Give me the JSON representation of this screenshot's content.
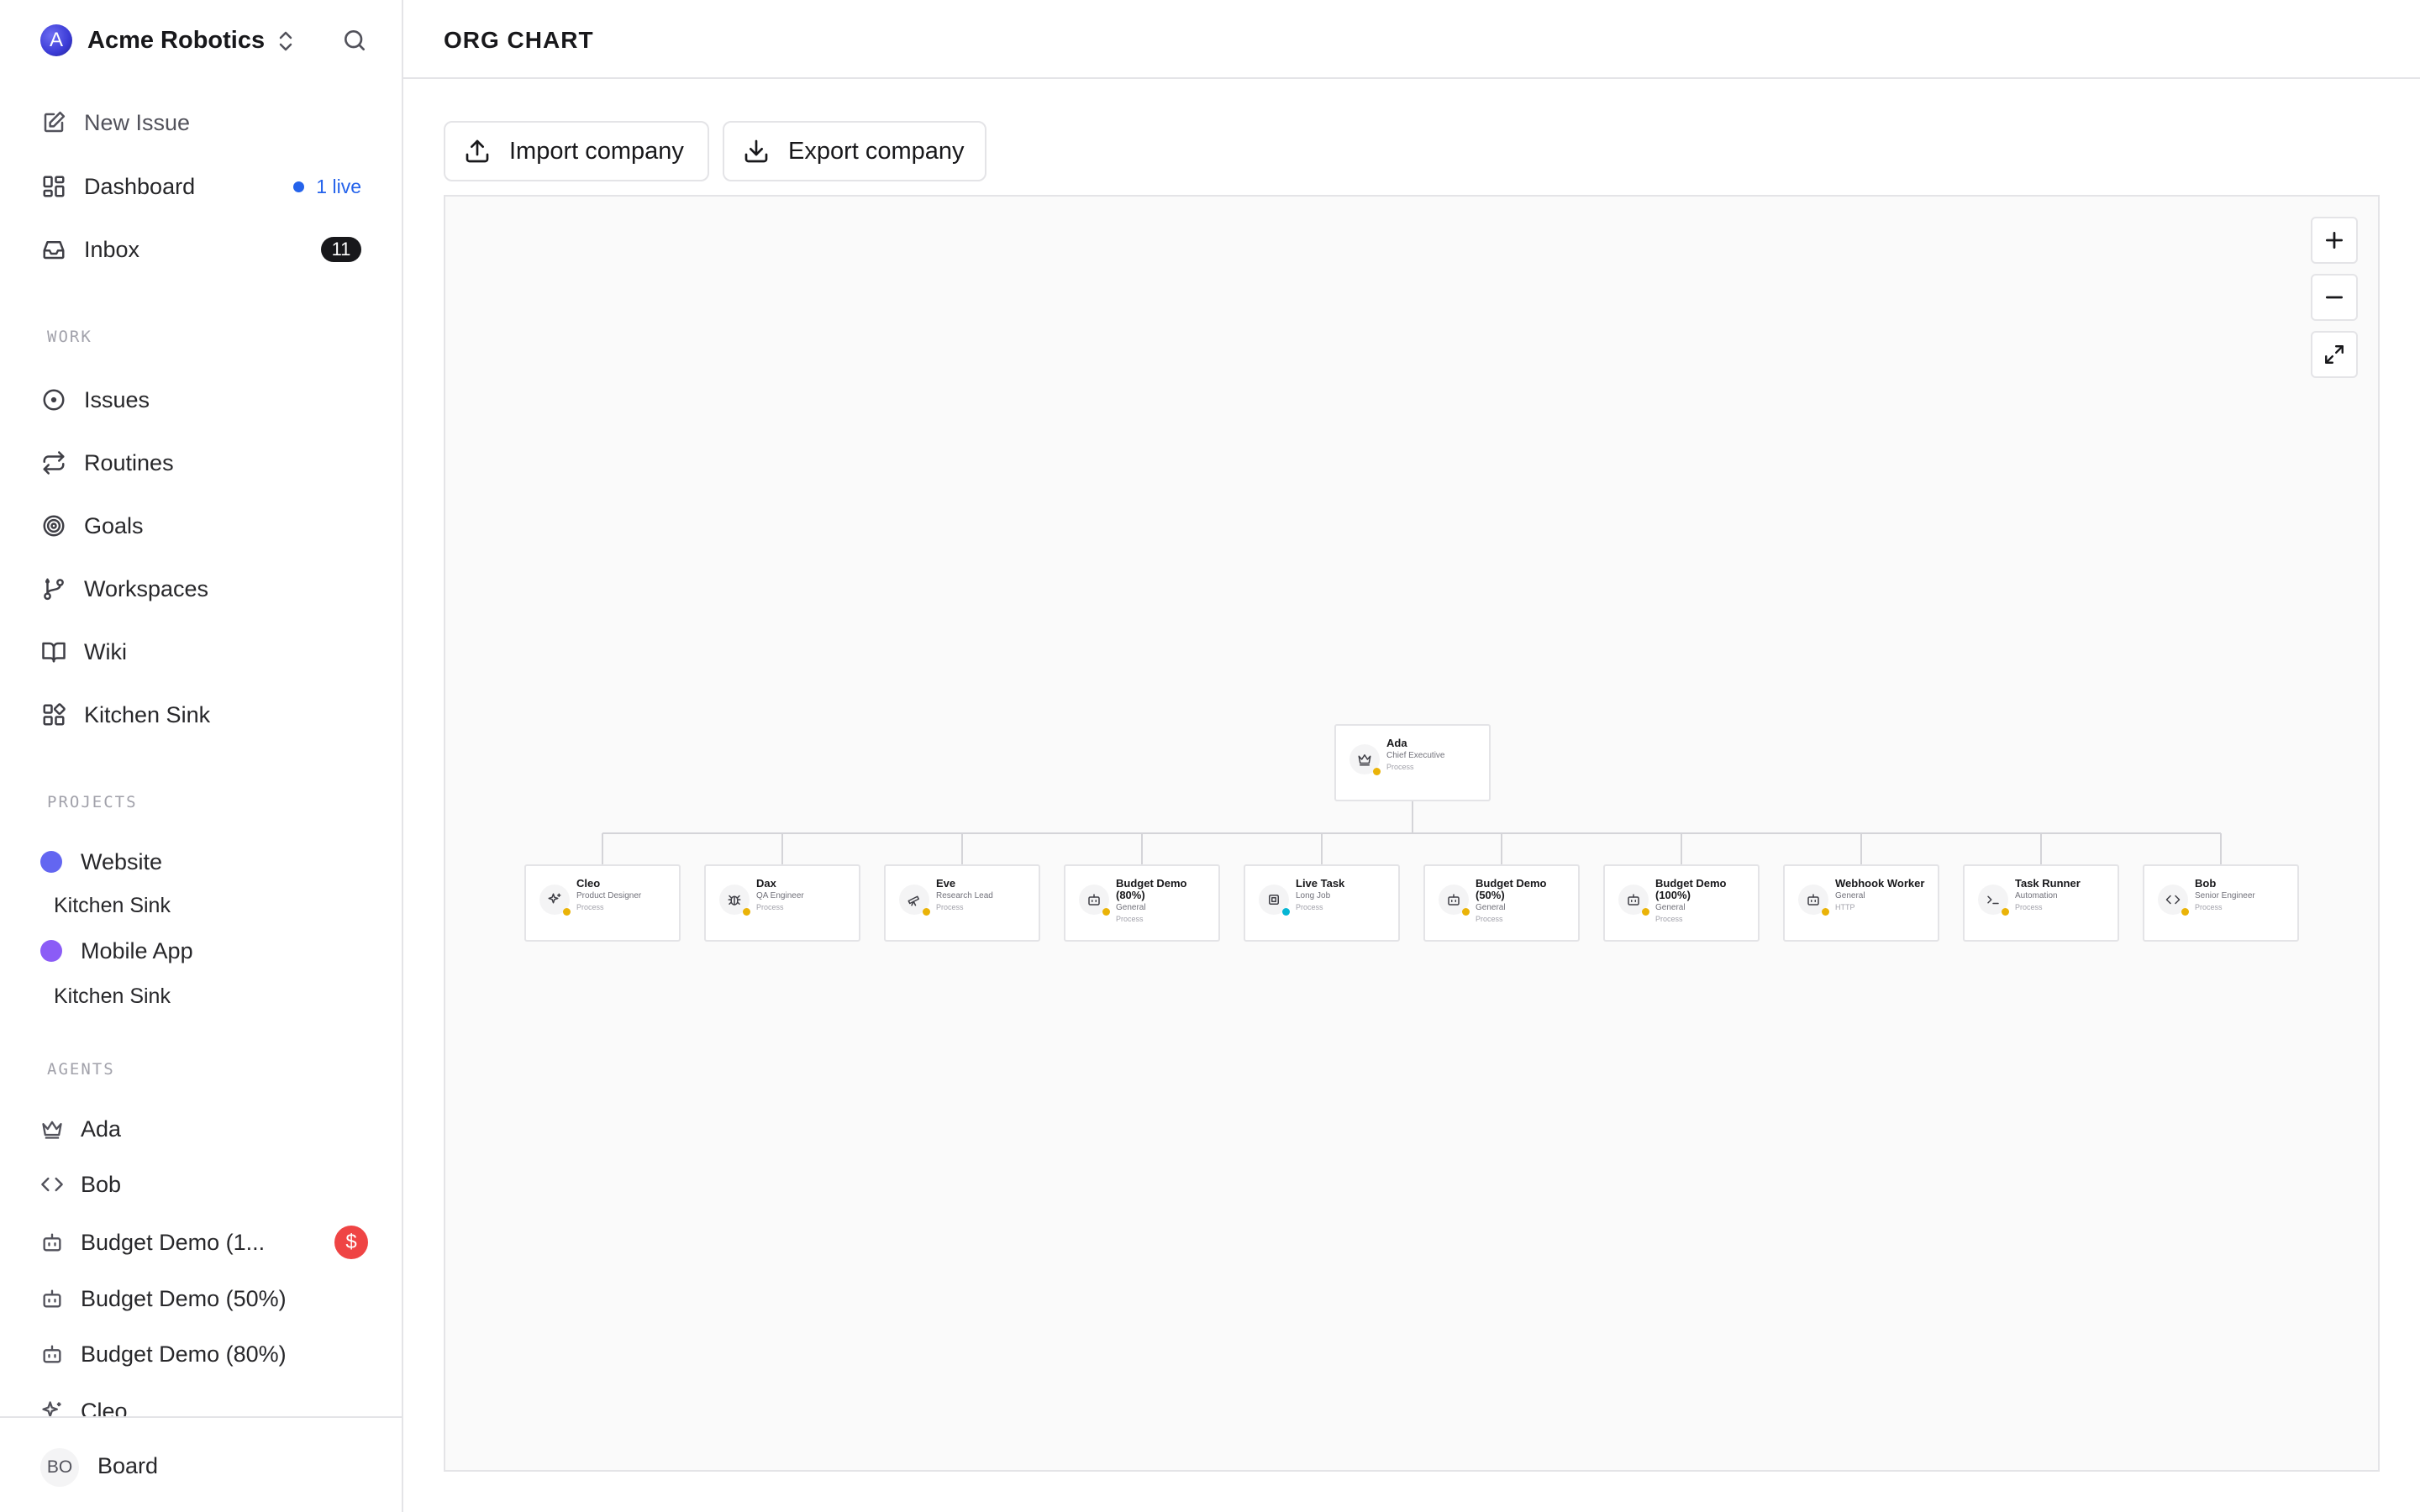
{
  "sidebar": {
    "company_name": "Acme Robotics",
    "company_initial": "A",
    "top_items": [
      {
        "label": "New Issue",
        "icon": "pencil-square-icon"
      },
      {
        "label": "Dashboard",
        "icon": "dashboard-grid-icon",
        "live": "1 live"
      },
      {
        "label": "Inbox",
        "icon": "inbox-icon",
        "count": "11"
      }
    ],
    "work_label": "WORK",
    "work_items": [
      {
        "label": "Issues",
        "icon": "circle-dot-icon"
      },
      {
        "label": "Routines",
        "icon": "repeat-icon"
      },
      {
        "label": "Goals",
        "icon": "target-icon"
      },
      {
        "label": "Workspaces",
        "icon": "git-branch-icon"
      },
      {
        "label": "Wiki",
        "icon": "book-icon"
      },
      {
        "label": "Kitchen Sink",
        "icon": "blocks-icon"
      }
    ],
    "projects_label": "PROJECTS",
    "projects": [
      {
        "label": "Website",
        "color": "#6366f1",
        "sub": "Kitchen Sink"
      },
      {
        "label": "Mobile App",
        "color": "#8b5cf6",
        "sub": "Kitchen Sink"
      }
    ],
    "agents_label": "AGENTS",
    "agents": [
      {
        "label": "Ada",
        "icon": "crown-icon"
      },
      {
        "label": "Bob",
        "icon": "code-icon"
      },
      {
        "label": "Budget Demo (1...",
        "icon": "bot-icon",
        "budget_alert": "$"
      },
      {
        "label": "Budget Demo (50%)",
        "icon": "bot-icon"
      },
      {
        "label": "Budget Demo (80%)",
        "icon": "bot-icon"
      },
      {
        "label": "Cleo",
        "icon": "sparkles-icon"
      }
    ],
    "footer": {
      "initials": "BO",
      "label": "Board"
    }
  },
  "header": {
    "title": "ORG CHART"
  },
  "actions": {
    "import_label": "Import company",
    "export_label": "Export company"
  },
  "zoom_controls": {
    "zoom_in": "+",
    "zoom_out": "−"
  },
  "org_chart": {
    "root": {
      "name": "Ada",
      "role": "Chief Executive",
      "adapter": "Process",
      "status_color": "#eab308",
      "icon": "crown-icon"
    },
    "reports": [
      {
        "name": "Cleo",
        "role": "Product Designer",
        "adapter": "Process",
        "status_color": "#eab308",
        "icon": "sparkles-icon"
      },
      {
        "name": "Dax",
        "role": "QA Engineer",
        "adapter": "Process",
        "status_color": "#eab308",
        "icon": "bug-icon"
      },
      {
        "name": "Eve",
        "role": "Research Lead",
        "adapter": "Process",
        "status_color": "#eab308",
        "icon": "telescope-icon"
      },
      {
        "name": "Budget Demo (80%)",
        "role": "General",
        "adapter": "Process",
        "status_color": "#eab308",
        "icon": "bot-icon"
      },
      {
        "name": "Live Task",
        "role": "Long Job",
        "adapter": "Process",
        "status_color": "#06b6d4",
        "icon": "cpu-icon"
      },
      {
        "name": "Budget Demo (50%)",
        "role": "General",
        "adapter": "Process",
        "status_color": "#eab308",
        "icon": "bot-icon"
      },
      {
        "name": "Budget Demo (100%)",
        "role": "General",
        "adapter": "Process",
        "status_color": "#eab308",
        "icon": "bot-icon"
      },
      {
        "name": "Webhook Worker",
        "role": "General",
        "adapter": "HTTP",
        "status_color": "#eab308",
        "icon": "bot-icon"
      },
      {
        "name": "Task Runner",
        "role": "Automation",
        "adapter": "Process",
        "status_color": "#eab308",
        "icon": "terminal-icon"
      },
      {
        "name": "Bob",
        "role": "Senior Engineer",
        "adapter": "Process",
        "status_color": "#eab308",
        "icon": "code-icon"
      }
    ]
  }
}
